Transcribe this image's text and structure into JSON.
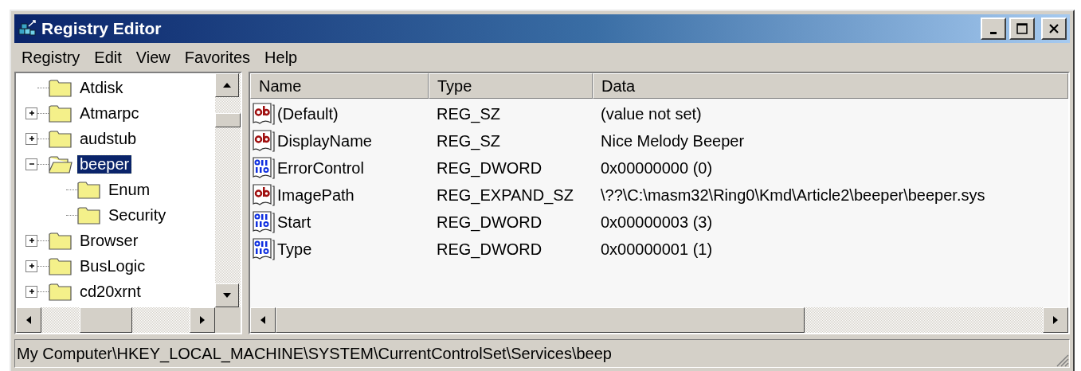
{
  "window": {
    "title": "Registry Editor"
  },
  "menu": [
    "Registry",
    "Edit",
    "View",
    "Favorites",
    "Help"
  ],
  "tree": [
    {
      "label": "Atdisk",
      "has_children": false,
      "expanded": false,
      "selected": false
    },
    {
      "label": "Atmarpc",
      "has_children": true,
      "expanded": false,
      "selected": false
    },
    {
      "label": "audstub",
      "has_children": true,
      "expanded": false,
      "selected": false
    },
    {
      "label": "beeper",
      "has_children": true,
      "expanded": true,
      "selected": true,
      "children": [
        {
          "label": "Enum",
          "has_children": false,
          "expanded": false,
          "selected": false
        },
        {
          "label": "Security",
          "has_children": false,
          "expanded": false,
          "selected": false
        }
      ]
    },
    {
      "label": "Browser",
      "has_children": true,
      "expanded": false,
      "selected": false
    },
    {
      "label": "BusLogic",
      "has_children": true,
      "expanded": false,
      "selected": false
    },
    {
      "label": "cd20xrnt",
      "has_children": true,
      "expanded": false,
      "selected": false
    }
  ],
  "table": {
    "columns": [
      "Name",
      "Type",
      "Data"
    ],
    "rows": [
      {
        "kind": "string",
        "name": "(Default)",
        "type": "REG_SZ",
        "data": "(value not set)"
      },
      {
        "kind": "string",
        "name": "DisplayName",
        "type": "REG_SZ",
        "data": "Nice Melody Beeper"
      },
      {
        "kind": "dword",
        "name": "ErrorControl",
        "type": "REG_DWORD",
        "data": "0x00000000 (0)"
      },
      {
        "kind": "string",
        "name": "ImagePath",
        "type": "REG_EXPAND_SZ",
        "data": "\\??\\C:\\masm32\\Ring0\\Kmd\\Article2\\beeper\\beeper.sys"
      },
      {
        "kind": "dword",
        "name": "Start",
        "type": "REG_DWORD",
        "data": "0x00000003 (3)"
      },
      {
        "kind": "dword",
        "name": "Type",
        "type": "REG_DWORD",
        "data": "0x00000001 (1)"
      }
    ]
  },
  "status_bar": "My Computer\\HKEY_LOCAL_MACHINE\\SYSTEM\\CurrentControlSet\\Services\\beep"
}
